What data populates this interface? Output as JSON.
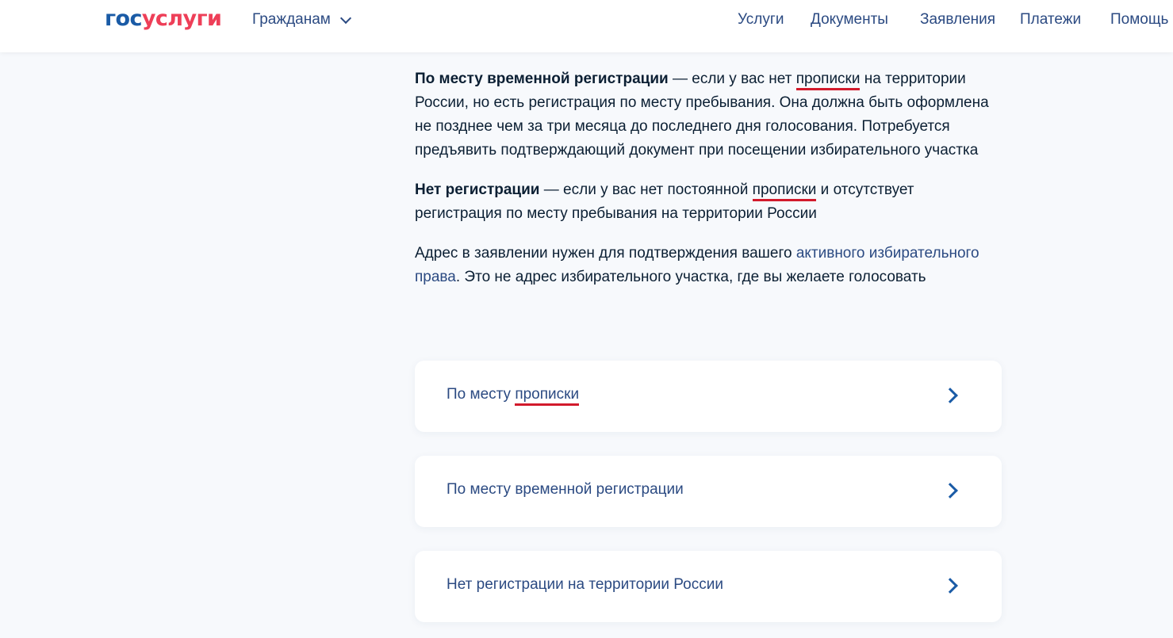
{
  "header": {
    "logo_part1": "гос",
    "logo_part2": "услуги",
    "audience_dropdown": "Гражданам",
    "nav": [
      "Услуги",
      "Документы",
      "Заявления",
      "Платежи",
      "Помощь"
    ]
  },
  "content": {
    "p1": {
      "bold": "По месту временной регистрации",
      "t1": " — если у вас нет ",
      "underlined": "прописки",
      "t2": " на территории России, но есть регистрация по месту пребывания. Она должна быть оформлена не позднее чем за три месяца до последнего дня голосования. Потребуется предъявить подтверждающий документ при посещении избирательного участка"
    },
    "p2": {
      "bold": "Нет регистрации",
      "t1": " — если у вас нет постоянной ",
      "underlined": "прописки",
      "t2": " и отсутствует регистрация по месту пребывания на территории России"
    },
    "p3": {
      "t1": "Адрес в заявлении нужен для подтверждения вашего ",
      "link": "активного избирательного права",
      "t2": ". Это не адрес избирательного участка, где вы желаете голосовать"
    }
  },
  "options": [
    {
      "label_a": "По месту ",
      "label_b": "прописки"
    },
    {
      "label_a": "По месту временной регистрации",
      "label_b": ""
    },
    {
      "label_a": "Нет регистрации на территории России",
      "label_b": ""
    }
  ],
  "colors": {
    "link": "#2b4a82",
    "logo_blue": "#1a5ba6",
    "logo_red": "#ee3f58",
    "underline_annotation": "#d21a2c",
    "background": "#f7f9fc"
  }
}
